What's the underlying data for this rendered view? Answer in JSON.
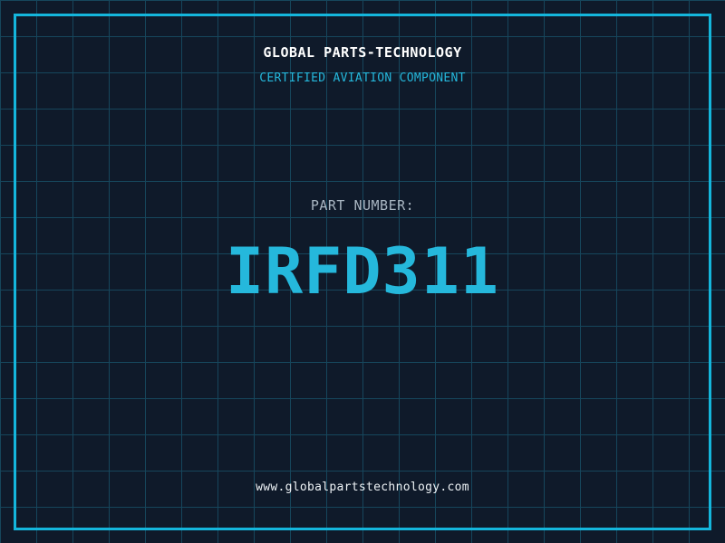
{
  "theme": {
    "background_color": "#0f1a2a",
    "grid_color": "#16465c",
    "frame_color": "#14b6dc",
    "accent_color": "#25b8dc",
    "title_color": "#ffffff",
    "label_color": "#a9b6c2",
    "url_color": "#eef3f6"
  },
  "header": {
    "title": "GLOBAL PARTS-TECHNOLOGY",
    "subtitle": "CERTIFIED AVIATION COMPONENT"
  },
  "part": {
    "label": "PART NUMBER:",
    "number": "IRFD311"
  },
  "footer": {
    "website": "www.globalpartstechnology.com"
  }
}
